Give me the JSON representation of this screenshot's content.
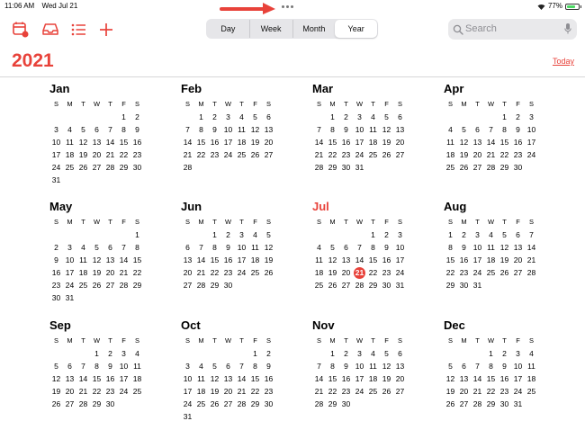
{
  "status": {
    "time": "11:06 AM",
    "date": "Wed Jul 21",
    "battery": "77%"
  },
  "view_switcher": {
    "options": [
      "Day",
      "Week",
      "Month",
      "Year"
    ],
    "selected": "Year"
  },
  "search": {
    "placeholder": "Search"
  },
  "header": {
    "year": "2021",
    "today_label": "Today"
  },
  "colors": {
    "accent": "#e8423a"
  },
  "weekday_headers": [
    "S",
    "M",
    "T",
    "W",
    "T",
    "F",
    "S"
  ],
  "today": {
    "month": "Jul",
    "day": 21
  },
  "months": [
    {
      "name": "Jan",
      "start": 5,
      "days": 31
    },
    {
      "name": "Feb",
      "start": 1,
      "days": 28
    },
    {
      "name": "Mar",
      "start": 1,
      "days": 31
    },
    {
      "name": "Apr",
      "start": 4,
      "days": 30
    },
    {
      "name": "May",
      "start": 6,
      "days": 31
    },
    {
      "name": "Jun",
      "start": 2,
      "days": 30
    },
    {
      "name": "Jul",
      "start": 4,
      "days": 31
    },
    {
      "name": "Aug",
      "start": 0,
      "days": 31
    },
    {
      "name": "Sep",
      "start": 3,
      "days": 30
    },
    {
      "name": "Oct",
      "start": 5,
      "days": 31
    },
    {
      "name": "Nov",
      "start": 1,
      "days": 30
    },
    {
      "name": "Dec",
      "start": 3,
      "days": 31
    }
  ]
}
